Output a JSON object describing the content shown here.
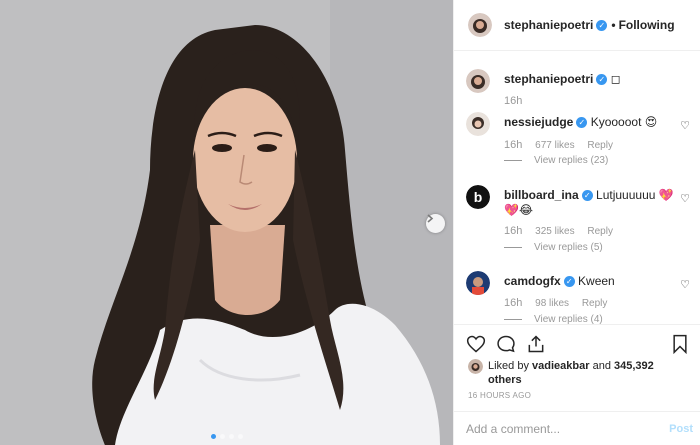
{
  "header": {
    "username": "stephaniepoetri",
    "verified_glyph": "✓",
    "separator": "•",
    "follow_label": "Following"
  },
  "caption": {
    "username": "stephaniepoetri",
    "text": "◻",
    "time": "16h"
  },
  "comments": [
    {
      "username": "nessiejudge",
      "text": "Kyooooot 😍",
      "time": "16h",
      "likes": "677 likes",
      "reply": "Reply",
      "view_replies": "View replies (23)"
    },
    {
      "username": "billboard_ina",
      "text": "Lutjuuuuuu 💖💖😂",
      "time": "16h",
      "likes": "325 likes",
      "reply": "Reply",
      "view_replies": "View replies (5)"
    },
    {
      "username": "camdogfx",
      "text": "Kween",
      "time": "16h",
      "likes": "98 likes",
      "reply": "Reply",
      "view_replies": "View replies (4)"
    }
  ],
  "likes": {
    "prefix": "Liked by",
    "user": "vadieakbar",
    "joiner": "and",
    "count": "345,392 others"
  },
  "timestamp": "16 HOURS AGO",
  "add_comment": {
    "placeholder": "Add a comment...",
    "post_label": "Post"
  },
  "carousel": {
    "slide_count": 4,
    "active_index": 0
  },
  "colors": {
    "verified": "#3897f0",
    "post_disabled": "#b2dffc",
    "muted": "#999999"
  },
  "icons": [
    "chevron-right-icon",
    "heart-icon",
    "comment-icon",
    "share-icon",
    "bookmark-icon"
  ]
}
